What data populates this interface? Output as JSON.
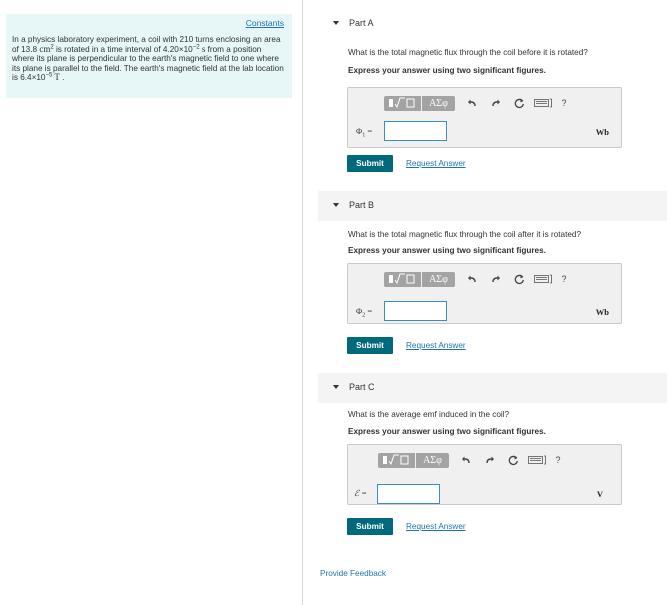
{
  "constants_link": "Constants",
  "problem": {
    "p1": "In a physics laboratory experiment, a coil with 210 turns enclosing an area of 13.8 ",
    "p1_unit": "cm",
    "p1_sup": "2",
    "p2": " is rotated in a time interval of 4.20×10",
    "p2_sup": "−2",
    "p2_unit": " s",
    "p3": " from a position where its plane is perpendicular to the earth's magnetic field to one where its plane is parallel to the field. The earth's magnetic field at the lab location is 6.4×10",
    "p3_sup": "−5",
    "p3_unit": " T",
    "p3_end": " ."
  },
  "toolbar": {
    "templates_icon": "sqrt-template-icon",
    "symbols_label": "ΑΣφ",
    "undo_icon": "undo-icon",
    "redo_icon": "redo-icon",
    "reset_icon": "reset-icon",
    "keyboard_icon": "keyboard-icon",
    "help_label": "?"
  },
  "parts": [
    {
      "title": "Part A",
      "question": "What is the total magnetic flux through the coil before it is rotated?",
      "instruction": "Express your answer using two significant figures.",
      "variable": "Φ",
      "variable_sub": "1",
      "equals": " =",
      "input_value": "",
      "unit": "Wb",
      "submit_label": "Submit",
      "request_label": "Request Answer"
    },
    {
      "title": "Part B",
      "question": "What is the total magnetic flux through the coil after it is rotated?",
      "instruction": "Express your answer using two significant figures.",
      "variable": "Φ",
      "variable_sub": "2",
      "equals": " =",
      "input_value": "",
      "unit": "Wb",
      "submit_label": "Submit",
      "request_label": "Request Answer"
    },
    {
      "title": "Part C",
      "question": "What is the average emf induced in the coil?",
      "instruction": "Express your answer using two significant figures.",
      "variable": "ℰ",
      "variable_sub": "",
      "equals": " =",
      "input_value": "",
      "unit": "V",
      "submit_label": "Submit",
      "request_label": "Request Answer"
    }
  ],
  "feedback_link": "Provide Feedback",
  "colors": {
    "panel_bg": "#e7f6f6",
    "submit_bg": "#00697c",
    "link": "#1f76b6",
    "input_border": "#3a8dc8"
  }
}
